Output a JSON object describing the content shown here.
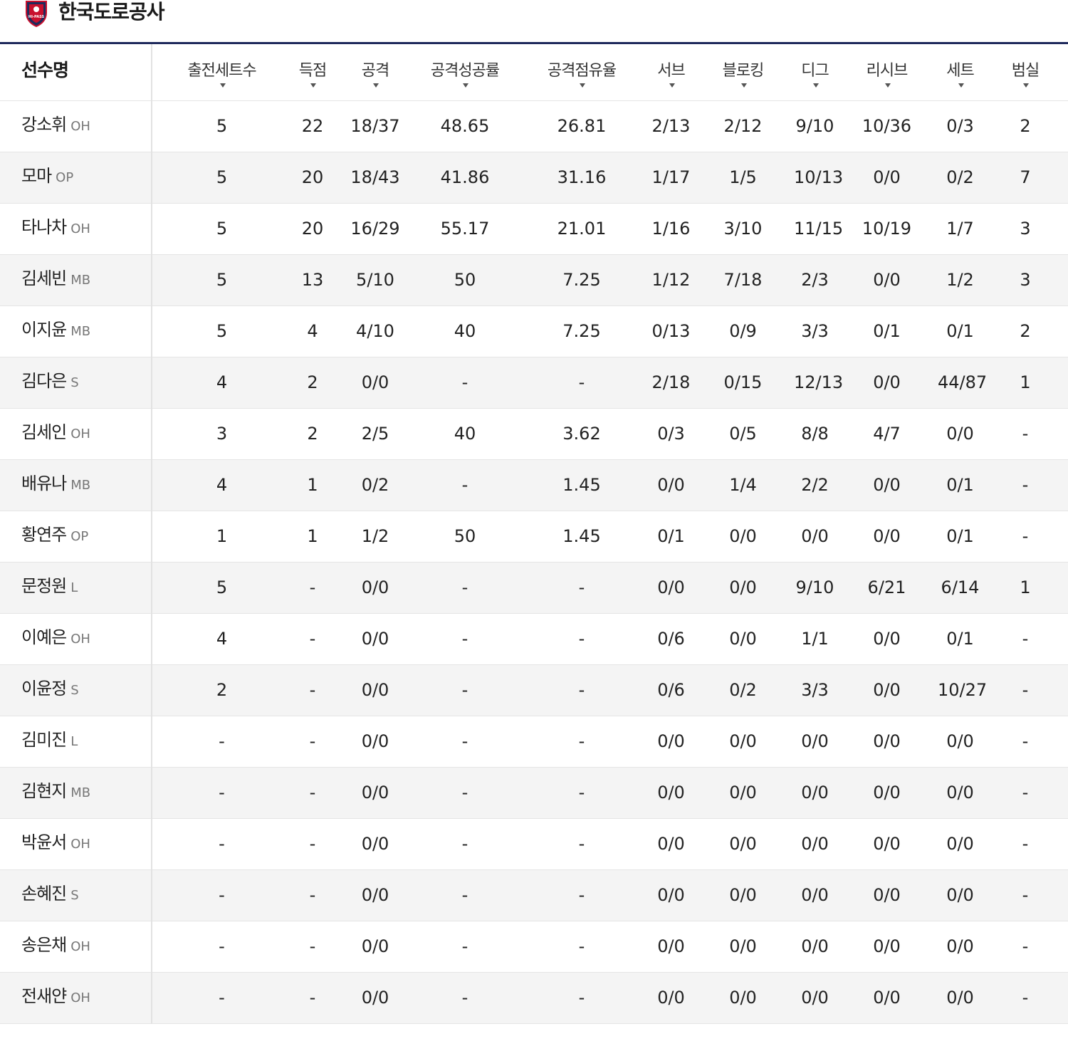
{
  "team": {
    "name": "한국도로공사",
    "logo_icon": "team-shield-emblem-icon",
    "logo_text": "HI-PASS",
    "colors": {
      "primary": "#1f2a5c",
      "accent": "#c8102e"
    }
  },
  "table": {
    "columns": [
      "선수명",
      "출전세트수",
      "득점",
      "공격",
      "공격성공률",
      "공격점유율",
      "서브",
      "블로킹",
      "디그",
      "리시브",
      "세트",
      "범실"
    ],
    "rows": [
      {
        "name": "강소휘",
        "pos": "OH",
        "stats": [
          "5",
          "22",
          "18/37",
          "48.65",
          "26.81",
          "2/13",
          "2/12",
          "9/10",
          "10/36",
          "0/3",
          "2"
        ]
      },
      {
        "name": "모마",
        "pos": "OP",
        "stats": [
          "5",
          "20",
          "18/43",
          "41.86",
          "31.16",
          "1/17",
          "1/5",
          "10/13",
          "0/0",
          "0/2",
          "7"
        ]
      },
      {
        "name": "타나차",
        "pos": "OH",
        "stats": [
          "5",
          "20",
          "16/29",
          "55.17",
          "21.01",
          "1/16",
          "3/10",
          "11/15",
          "10/19",
          "1/7",
          "3"
        ]
      },
      {
        "name": "김세빈",
        "pos": "MB",
        "stats": [
          "5",
          "13",
          "5/10",
          "50",
          "7.25",
          "1/12",
          "7/18",
          "2/3",
          "0/0",
          "1/2",
          "3"
        ]
      },
      {
        "name": "이지윤",
        "pos": "MB",
        "stats": [
          "5",
          "4",
          "4/10",
          "40",
          "7.25",
          "0/13",
          "0/9",
          "3/3",
          "0/1",
          "0/1",
          "2"
        ]
      },
      {
        "name": "김다은",
        "pos": "S",
        "stats": [
          "4",
          "2",
          "0/0",
          "-",
          "-",
          "2/18",
          "0/15",
          "12/13",
          "0/0",
          "44/87",
          "1"
        ]
      },
      {
        "name": "김세인",
        "pos": "OH",
        "stats": [
          "3",
          "2",
          "2/5",
          "40",
          "3.62",
          "0/3",
          "0/5",
          "8/8",
          "4/7",
          "0/0",
          "-"
        ]
      },
      {
        "name": "배유나",
        "pos": "MB",
        "stats": [
          "4",
          "1",
          "0/2",
          "-",
          "1.45",
          "0/0",
          "1/4",
          "2/2",
          "0/0",
          "0/1",
          "-"
        ]
      },
      {
        "name": "황연주",
        "pos": "OP",
        "stats": [
          "1",
          "1",
          "1/2",
          "50",
          "1.45",
          "0/1",
          "0/0",
          "0/0",
          "0/0",
          "0/1",
          "-"
        ]
      },
      {
        "name": "문정원",
        "pos": "L",
        "stats": [
          "5",
          "-",
          "0/0",
          "-",
          "-",
          "0/0",
          "0/0",
          "9/10",
          "6/21",
          "6/14",
          "1"
        ]
      },
      {
        "name": "이예은",
        "pos": "OH",
        "stats": [
          "4",
          "-",
          "0/0",
          "-",
          "-",
          "0/6",
          "0/0",
          "1/1",
          "0/0",
          "0/1",
          "-"
        ]
      },
      {
        "name": "이윤정",
        "pos": "S",
        "stats": [
          "2",
          "-",
          "0/0",
          "-",
          "-",
          "0/6",
          "0/2",
          "3/3",
          "0/0",
          "10/27",
          "-"
        ]
      },
      {
        "name": "김미진",
        "pos": "L",
        "stats": [
          "-",
          "-",
          "0/0",
          "-",
          "-",
          "0/0",
          "0/0",
          "0/0",
          "0/0",
          "0/0",
          "-"
        ]
      },
      {
        "name": "김현지",
        "pos": "MB",
        "stats": [
          "-",
          "-",
          "0/0",
          "-",
          "-",
          "0/0",
          "0/0",
          "0/0",
          "0/0",
          "0/0",
          "-"
        ]
      },
      {
        "name": "박윤서",
        "pos": "OH",
        "stats": [
          "-",
          "-",
          "0/0",
          "-",
          "-",
          "0/0",
          "0/0",
          "0/0",
          "0/0",
          "0/0",
          "-"
        ]
      },
      {
        "name": "손혜진",
        "pos": "S",
        "stats": [
          "-",
          "-",
          "0/0",
          "-",
          "-",
          "0/0",
          "0/0",
          "0/0",
          "0/0",
          "0/0",
          "-"
        ]
      },
      {
        "name": "송은채",
        "pos": "OH",
        "stats": [
          "-",
          "-",
          "0/0",
          "-",
          "-",
          "0/0",
          "0/0",
          "0/0",
          "0/0",
          "0/0",
          "-"
        ]
      },
      {
        "name": "전새얀",
        "pos": "OH",
        "stats": [
          "-",
          "-",
          "0/0",
          "-",
          "-",
          "0/0",
          "0/0",
          "0/0",
          "0/0",
          "0/0",
          "-"
        ]
      }
    ]
  }
}
